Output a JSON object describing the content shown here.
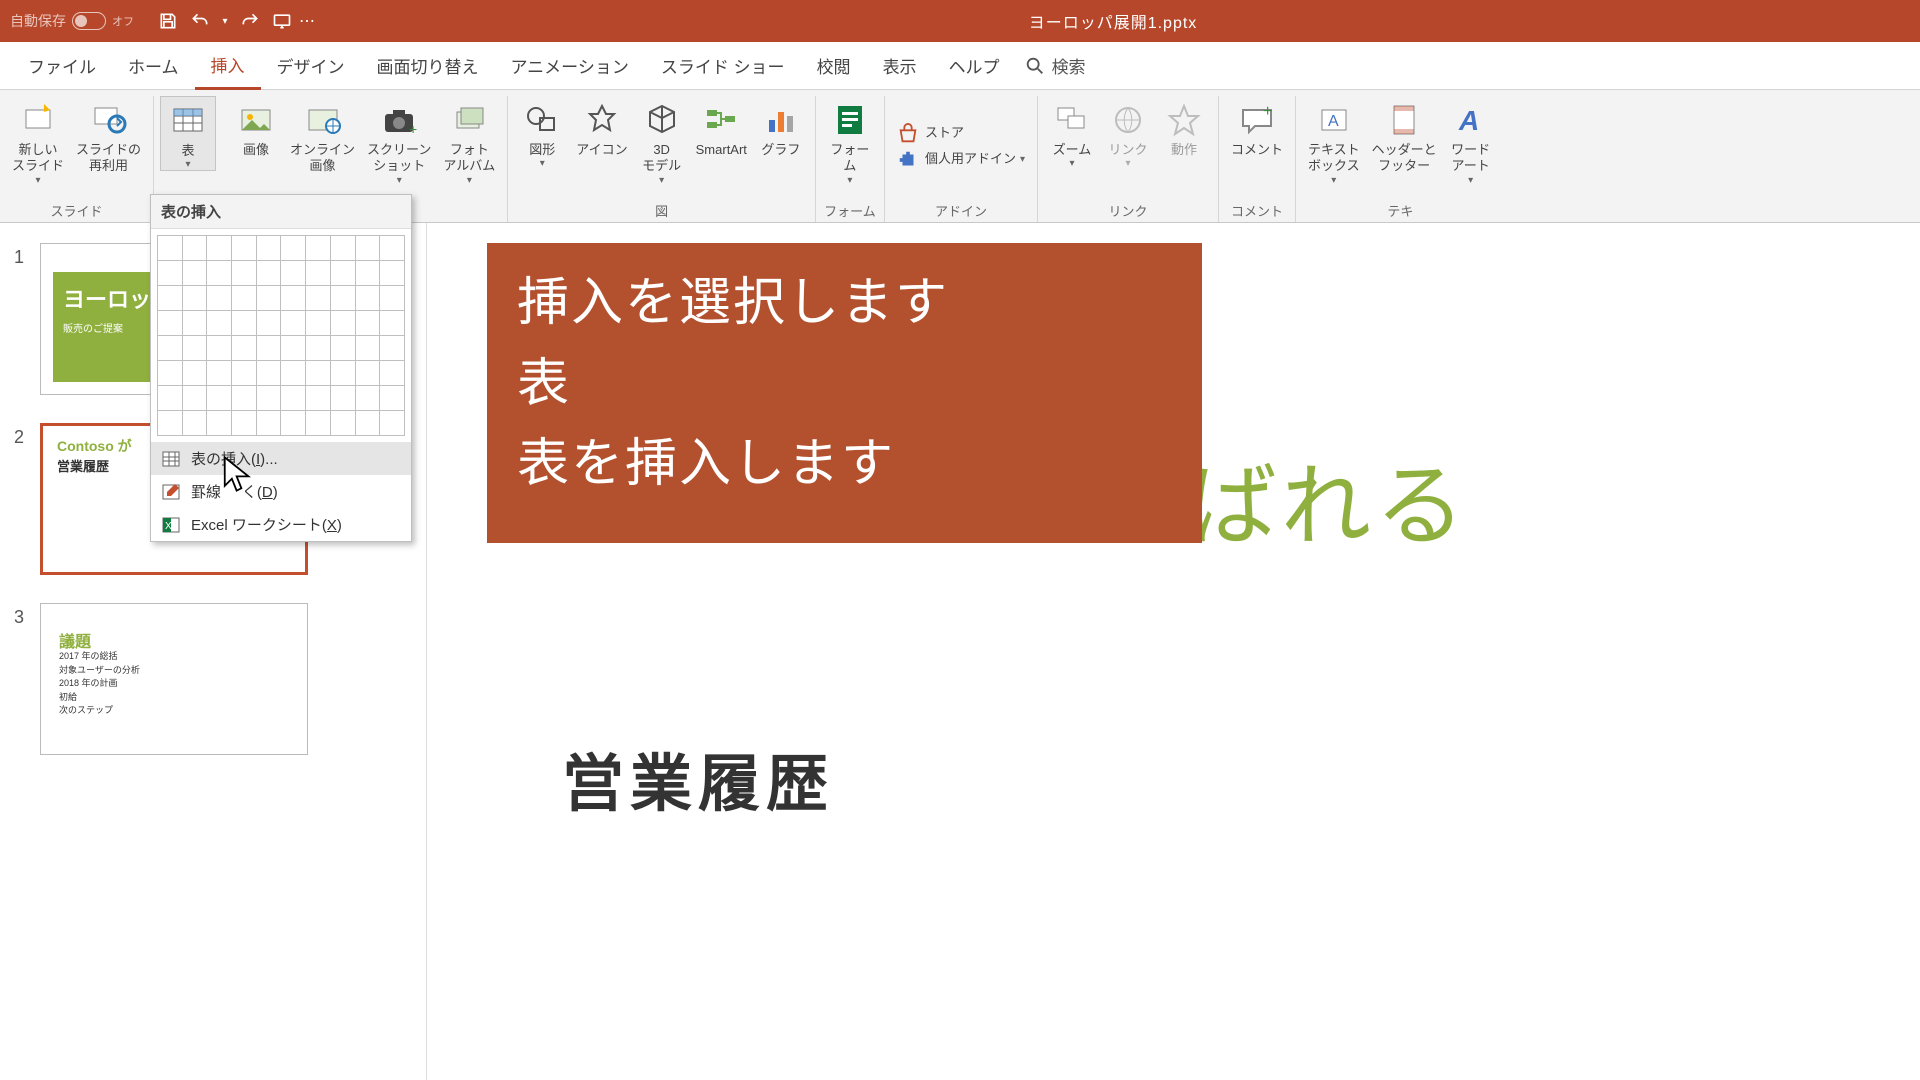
{
  "titlebar": {
    "autosave_label": "自動保存",
    "autosave_state": "オフ",
    "filename": "ヨーロッパ展開1.pptx"
  },
  "tabs": {
    "file": "ファイル",
    "home": "ホーム",
    "insert": "挿入",
    "design": "デザイン",
    "trans": "画面切り替え",
    "anim": "アニメーション",
    "slideshow": "スライド ショー",
    "review": "校閲",
    "view": "表示",
    "help": "ヘルプ",
    "search": "検索"
  },
  "ribbon": {
    "slides_grp": "スライド",
    "new_slide": "新しい\nスライド",
    "reuse": "スライドの\n再利用",
    "table": "表",
    "image": "画像",
    "online_img": "オンライン\n画像",
    "screenshot": "スクリーン\nショット",
    "photo_album": "フォト\nアルバム",
    "illust_grp": "図",
    "shapes": "図形",
    "icons": "アイコン",
    "model3d": "3D\nモデル",
    "smartart": "SmartArt",
    "chart": "グラフ",
    "form_grp": "フォーム",
    "forms": "フォー\nム",
    "addin_grp": "アドイン",
    "store": "ストア",
    "my_addins": "個人用アドイン",
    "link_grp": "リンク",
    "zoom": "ズーム",
    "link": "リンク",
    "action": "動作",
    "comment_grp": "コメント",
    "comment": "コメント",
    "text_grp": "テキ",
    "textbox": "テキスト\nボックス",
    "header_footer": "ヘッダーと\nフッター",
    "wordart": "ワード\nアート"
  },
  "table_dd": {
    "title": "表の挿入",
    "insert_table": "表の挿入(",
    "insert_table_k": "I",
    "insert_table_sfx": ")...",
    "draw_table": "罫線",
    "draw_table_mid": "く(",
    "draw_table_k": "D",
    "draw_table_sfx": ")",
    "excel": "Excel ワークシート(",
    "excel_k": "X",
    "excel_sfx": ")"
  },
  "thumbs": {
    "n1": "1",
    "n2": "2",
    "n3": "3",
    "s1_title": "ヨーロッ",
    "s1_sub": "販売のご提案",
    "s2_line1": "Contoso が",
    "s2_line2": "営業履歴",
    "s3_title": "議題",
    "s3_i1": "2017 年の総括",
    "s3_i2": "対象ユーザーの分析",
    "s3_i3": "2018 年の計画",
    "s3_i4": "初給",
    "s3_i5": "次のステップ"
  },
  "canvas": {
    "bg_text": "ばれる",
    "sub_text": "営業履歴"
  },
  "callout": {
    "l1": "挿入を選択します",
    "l2": "表",
    "l3": "表を挿入します"
  }
}
